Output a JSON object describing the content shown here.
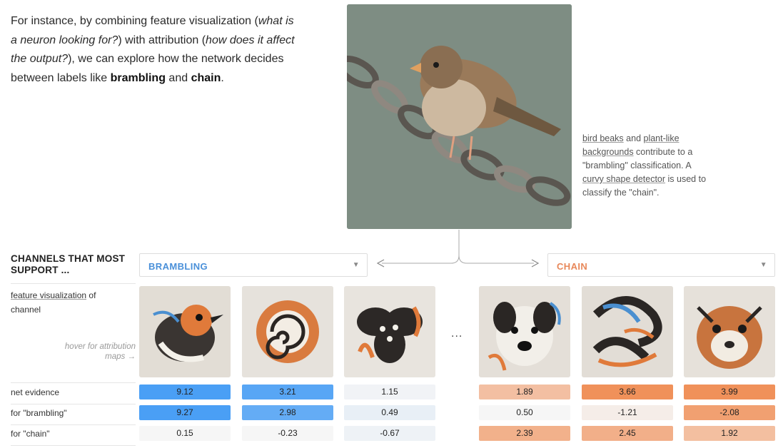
{
  "intro": {
    "t1": "For instance, by combining feature visualization (",
    "e1": "what is a neuron looking for?",
    "t2": ") with attribution (",
    "e2": "how does it affect the output?",
    "t3": "), we can explore how the network decides between labels like ",
    "b1": "brambling",
    "t4": " and ",
    "b2": "chain",
    "t5": "."
  },
  "caption": {
    "u1": "bird beaks",
    "t1": " and ",
    "u2": "plant-like backgrounds",
    "t2": " contribute to a \"brambling\" classification. A ",
    "u3": "curvy shape detector",
    "t3": " is used to classify the \"chain\"."
  },
  "support_title": "CHANNELS THAT MOST SUPPORT ...",
  "select_brambling": "BRAMBLING",
  "select_chain": "CHAIN",
  "select_arrow": "▼",
  "rowlabels": {
    "fv_link": "feature visualization",
    "fv_rest": " of channel",
    "hint": "hover for attribution maps →",
    "net": "net evidence",
    "brambling": "for \"brambling\"",
    "chain": "for \"chain\""
  },
  "ellipsis": "...",
  "colors": {
    "blue": "#4a9ff5",
    "orange": "#f0915a",
    "neutral": "#e6e6e6"
  },
  "rows": {
    "net": [
      "9.12",
      "3.21",
      "1.15",
      "1.89",
      "3.66",
      "3.99"
    ],
    "brambling": [
      "9.27",
      "2.98",
      "0.49",
      "0.50",
      "-1.21",
      "-2.08"
    ],
    "chain": [
      "0.15",
      "-0.23",
      "-0.67",
      "2.39",
      "2.45",
      "1.92"
    ]
  }
}
